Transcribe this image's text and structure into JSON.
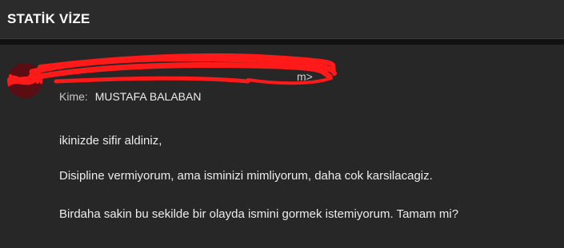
{
  "header": {
    "title": "STATİK VİZE"
  },
  "message": {
    "sender_visible": "m>",
    "recipient_label": "Kime:",
    "recipient_name": "MUSTAFA BALABAN",
    "body": [
      "ikinizde sifir aldiniz,",
      "Disipline vermiyorum, ama isminizi mimliyorum, daha cok karsilacagiz.",
      "Birdaha sakin bu sekilde bir olayda ismini gormek istemiyorum. Tamam mi?"
    ]
  },
  "colors": {
    "background": "#272727",
    "header_background": "#2b2b2b",
    "divider": "#111111",
    "avatar": "#5a0d12",
    "redaction": "#ff1a1a"
  }
}
